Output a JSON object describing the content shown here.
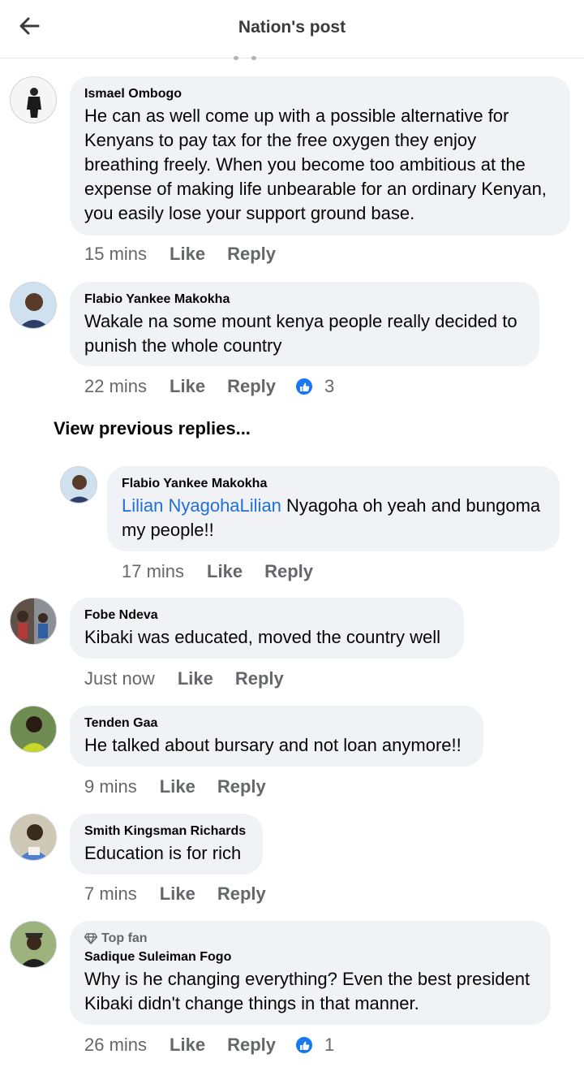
{
  "header": {
    "title": "Nation's post"
  },
  "comments": [
    {
      "author": "Ismael Ombogo",
      "text_lines": [
        "He can as well come up with a possible alternative for",
        "Kenyans to pay tax for the free oxygen they enjoy",
        "breathing freely.  When you become too ambitious at the",
        "expense of making life unbearable for an ordinary Kenyan,",
        "you easily lose your support ground base."
      ],
      "time": "15 mins",
      "like": "Like",
      "reply": "Reply"
    },
    {
      "author": "Flabio Yankee Makokha",
      "text_lines": [
        "Wakale na some mount kenya people really decided to",
        "punish the whole country"
      ],
      "time": "22 mins",
      "like": "Like",
      "reply": "Reply",
      "reaction_count": "3"
    },
    {
      "author": "Fobe Ndeva",
      "text_lines": [
        "Kibaki was educated, moved the country well"
      ],
      "time": "Just now",
      "like": "Like",
      "reply": "Reply"
    },
    {
      "author": "Tenden Gaa",
      "text_lines": [
        "He talked about bursary and not loan anymore!!"
      ],
      "time": "9 mins",
      "like": "Like",
      "reply": "Reply"
    },
    {
      "author": "Smith Kingsman Richards",
      "text_lines": [
        "Education is for rich"
      ],
      "time": "7 mins",
      "like": "Like",
      "reply": "Reply"
    },
    {
      "badge": "Top fan",
      "author": "Sadique Suleiman Fogo",
      "text_lines": [
        "Why is he changing everything? Even the best president",
        "Kibaki didn't change things in that manner."
      ],
      "time": "26 mins",
      "like": "Like",
      "reply": "Reply",
      "reaction_count": "1"
    }
  ],
  "view_previous": "View previous replies...",
  "reply_item": {
    "author": "Flabio Yankee Makokha",
    "mention": "Lilian NyagohaLilian",
    "text_first": " Nyagoha oh yeah and bungoma",
    "text_second": "my people!!",
    "time": "17 mins",
    "like": "Like",
    "reply": "Reply"
  },
  "colors": {
    "bubble": "#f0f2f5",
    "meta_text": "#65676b",
    "mention": "#216fdb",
    "like_reaction": "#1877f2"
  },
  "icons": {
    "back": "arrow-left-icon",
    "reaction": "thumbs-up-icon",
    "top_fan": "diamond-icon"
  }
}
